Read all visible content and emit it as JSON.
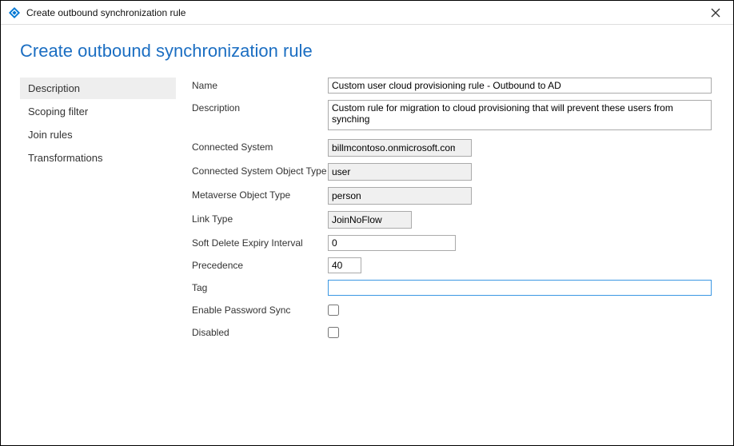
{
  "titlebar": {
    "title": "Create outbound synchronization rule"
  },
  "page": {
    "heading": "Create outbound synchronization rule"
  },
  "sidebar": {
    "items": [
      {
        "label": "Description"
      },
      {
        "label": "Scoping filter"
      },
      {
        "label": "Join rules"
      },
      {
        "label": "Transformations"
      }
    ],
    "active_index": 0
  },
  "form": {
    "name_label": "Name",
    "name_value": "Custom user cloud provisioning rule - Outbound to AD",
    "description_label": "Description",
    "description_value": "Custom rule for migration to cloud provisioning that will prevent these users from synching",
    "connected_system_label": "Connected System",
    "connected_system_value": "billmcontoso.onmicrosoft.com - ...",
    "cs_object_type_label": "Connected System Object Type",
    "cs_object_type_value": "user",
    "mv_object_type_label": "Metaverse Object Type",
    "mv_object_type_value": "person",
    "link_type_label": "Link Type",
    "link_type_value": "JoinNoFlow",
    "soft_delete_label": "Soft Delete Expiry Interval",
    "soft_delete_value": "0",
    "precedence_label": "Precedence",
    "precedence_value": "40",
    "tag_label": "Tag",
    "tag_value": "",
    "password_sync_label": "Enable Password Sync",
    "password_sync_checked": false,
    "disabled_label": "Disabled",
    "disabled_checked": false
  }
}
